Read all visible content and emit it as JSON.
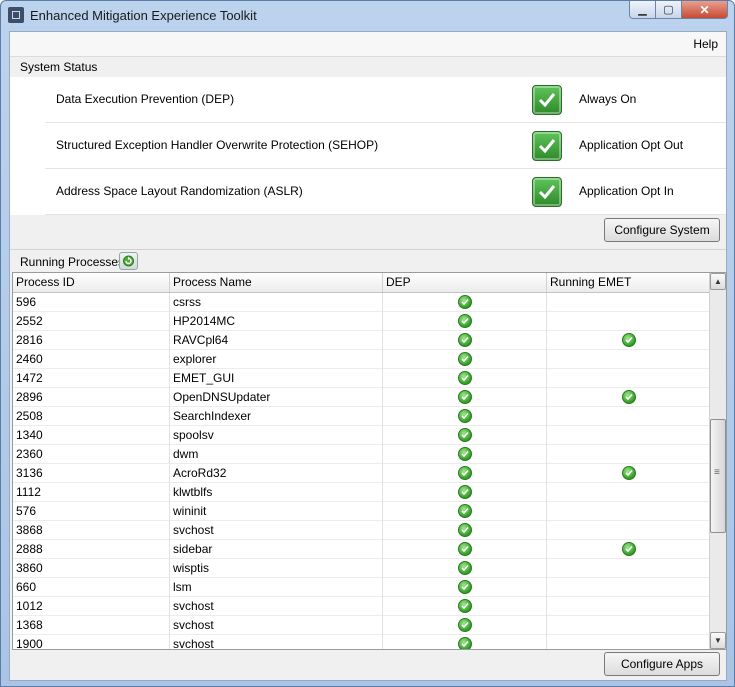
{
  "window": {
    "title": "Enhanced Mitigation Experience Toolkit"
  },
  "menu": {
    "help": "Help"
  },
  "system_status": {
    "label": "System Status",
    "rows": [
      {
        "name": "Data Execution Prevention (DEP)",
        "value": "Always On"
      },
      {
        "name": "Structured Exception Handler Overwrite Protection (SEHOP)",
        "value": "Application Opt Out"
      },
      {
        "name": "Address Space Layout Randomization (ASLR)",
        "value": "Application Opt In"
      }
    ],
    "configure_button": "Configure System"
  },
  "processes": {
    "label": "Running Processes",
    "columns": [
      "Process ID",
      "Process Name",
      "DEP",
      "Running EMET"
    ],
    "rows": [
      {
        "pid": "596",
        "name": "csrss",
        "dep": true,
        "emet": false
      },
      {
        "pid": "2552",
        "name": "HP2014MC",
        "dep": true,
        "emet": false
      },
      {
        "pid": "2816",
        "name": "RAVCpl64",
        "dep": true,
        "emet": true
      },
      {
        "pid": "2460",
        "name": "explorer",
        "dep": true,
        "emet": false
      },
      {
        "pid": "1472",
        "name": "EMET_GUI",
        "dep": true,
        "emet": false
      },
      {
        "pid": "2896",
        "name": "OpenDNSUpdater",
        "dep": true,
        "emet": true
      },
      {
        "pid": "2508",
        "name": "SearchIndexer",
        "dep": true,
        "emet": false
      },
      {
        "pid": "1340",
        "name": "spoolsv",
        "dep": true,
        "emet": false
      },
      {
        "pid": "2360",
        "name": "dwm",
        "dep": true,
        "emet": false
      },
      {
        "pid": "3136",
        "name": "AcroRd32",
        "dep": true,
        "emet": true
      },
      {
        "pid": "1112",
        "name": "klwtblfs",
        "dep": true,
        "emet": false
      },
      {
        "pid": "576",
        "name": "wininit",
        "dep": true,
        "emet": false
      },
      {
        "pid": "3868",
        "name": "svchost",
        "dep": true,
        "emet": false
      },
      {
        "pid": "2888",
        "name": "sidebar",
        "dep": true,
        "emet": true
      },
      {
        "pid": "3860",
        "name": "wisptis",
        "dep": true,
        "emet": false
      },
      {
        "pid": "660",
        "name": "lsm",
        "dep": true,
        "emet": false
      },
      {
        "pid": "1012",
        "name": "svchost",
        "dep": true,
        "emet": false
      },
      {
        "pid": "1368",
        "name": "svchost",
        "dep": true,
        "emet": false
      },
      {
        "pid": "1900",
        "name": "svchost",
        "dep": true,
        "emet": false
      }
    ],
    "configure_button": "Configure Apps"
  }
}
